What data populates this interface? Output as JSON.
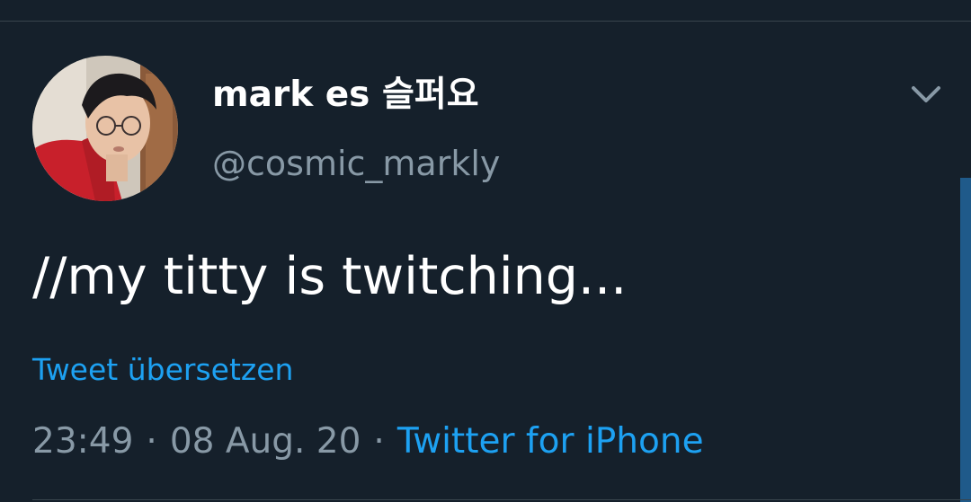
{
  "tweet": {
    "display_name": "mark es 슬퍼요",
    "handle": "@cosmic_markly",
    "text": "//my titty is twitching...",
    "translate_label": "Tweet übersetzen",
    "time": "23:49",
    "date": "08 Aug. 20",
    "separator": "·",
    "source": "Twitter for iPhone",
    "menu_icon": "chevron-down-icon",
    "avatar_icon": "avatar"
  },
  "colors": {
    "background": "#15202b",
    "accent": "#1da1f2",
    "secondary_text": "#8899a6",
    "primary_text": "#ffffff",
    "divider": "#38444d"
  }
}
